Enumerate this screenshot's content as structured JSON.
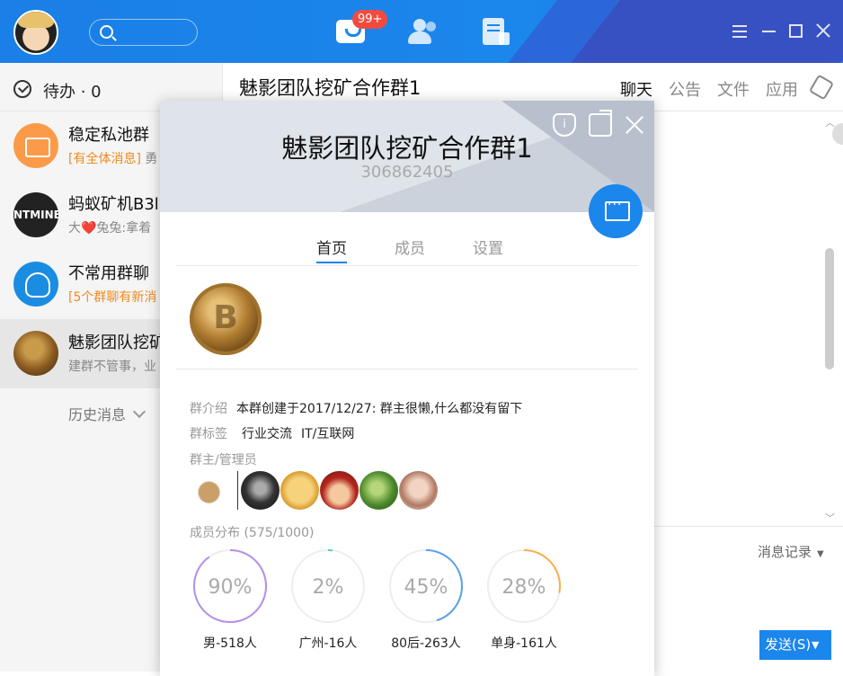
{
  "topbar": {
    "search_placeholder": "",
    "msg_badge": "99+",
    "icons": [
      "message-icon",
      "contacts-icon",
      "apps-icon"
    ]
  },
  "sidebar": {
    "todo_label": "待办 · 0",
    "conversations": [
      {
        "name": "稳定私池群",
        "preview_highlight": "[有全体消息]",
        "preview": " 勇",
        "avatar": "briefcase"
      },
      {
        "name": "蚂蚁矿机B3l",
        "preview_highlight": "",
        "preview": "大❤️兔兔:拿着",
        "avatar": "antminer",
        "avatar_text": "NTMINE"
      },
      {
        "name": "不常用群聊",
        "preview_highlight": "[5个群聊有新消",
        "preview": "",
        "avatar": "group"
      },
      {
        "name": "魅影团队挖矿",
        "preview_highlight": "",
        "preview": "建群不管事，业",
        "avatar": "coin"
      }
    ],
    "history_label": "历史消息"
  },
  "chat": {
    "title": "魅影团队挖矿合作群1",
    "tabs": [
      "聊天",
      "公告",
      "文件",
      "应用"
    ],
    "record_label": "消息记录",
    "send_label": "发送(S)"
  },
  "card": {
    "title": "魅影团队挖矿合作群1",
    "group_id": "306862405",
    "tabs": [
      "首页",
      "成员",
      "设置"
    ],
    "intro_key": "群介绍",
    "intro": "本群创建于2017/12/27:  群主很懒,什么都没有留下",
    "tags_key": "群标签",
    "tags": [
      "行业交流",
      "IT/互联网"
    ],
    "admins_key": "群主/管理员",
    "dist_label": "成员分布  (575/1000)",
    "stats": [
      {
        "pct": "90%",
        "value": 0.9,
        "label": "男-518人",
        "color": "#b58ee8"
      },
      {
        "pct": "2%",
        "value": 0.02,
        "label": "广州-16人",
        "color": "#4fd1a5"
      },
      {
        "pct": "45%",
        "value": 0.45,
        "label": "80后-263人",
        "color": "#5aa0ea"
      },
      {
        "pct": "28%",
        "value": 0.28,
        "label": "单身-161人",
        "color": "#f5b04a"
      }
    ]
  }
}
